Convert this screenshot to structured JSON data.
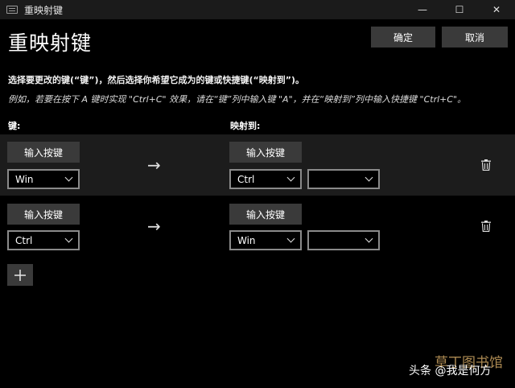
{
  "window": {
    "title": "重映射键",
    "minimize_glyph": "—",
    "maximize_glyph": "☐",
    "close_glyph": "✕"
  },
  "header": {
    "title": "重映射键",
    "ok_label": "确定",
    "cancel_label": "取消"
  },
  "instructions": {
    "main": "选择要更改的键(“键”)，然后选择你希望它成为的键或快捷键(“映射到”)。",
    "example": "例如，若要在按下 A 键时实现 \"Ctrl+C\" 效果，请在“键”列中输入键 \"A\"，并在“映射到”列中输入快捷键 \"Ctrl+C\"。"
  },
  "columns": {
    "key": "键:",
    "mapped_to": "映射到:"
  },
  "mappings": [
    {
      "type_key_label": "输入按键",
      "key": "Win",
      "arrow": "→",
      "type_target_label": "输入按键",
      "target_1": "Ctrl",
      "target_2": ""
    },
    {
      "type_key_label": "输入按键",
      "key": "Ctrl",
      "arrow": "→",
      "type_target_label": "输入按键",
      "target_1": "Win",
      "target_2": ""
    }
  ],
  "add_button_glyph": "+",
  "watermark": {
    "text": "头条 @我是何方",
    "site": "草丁图书馆"
  }
}
